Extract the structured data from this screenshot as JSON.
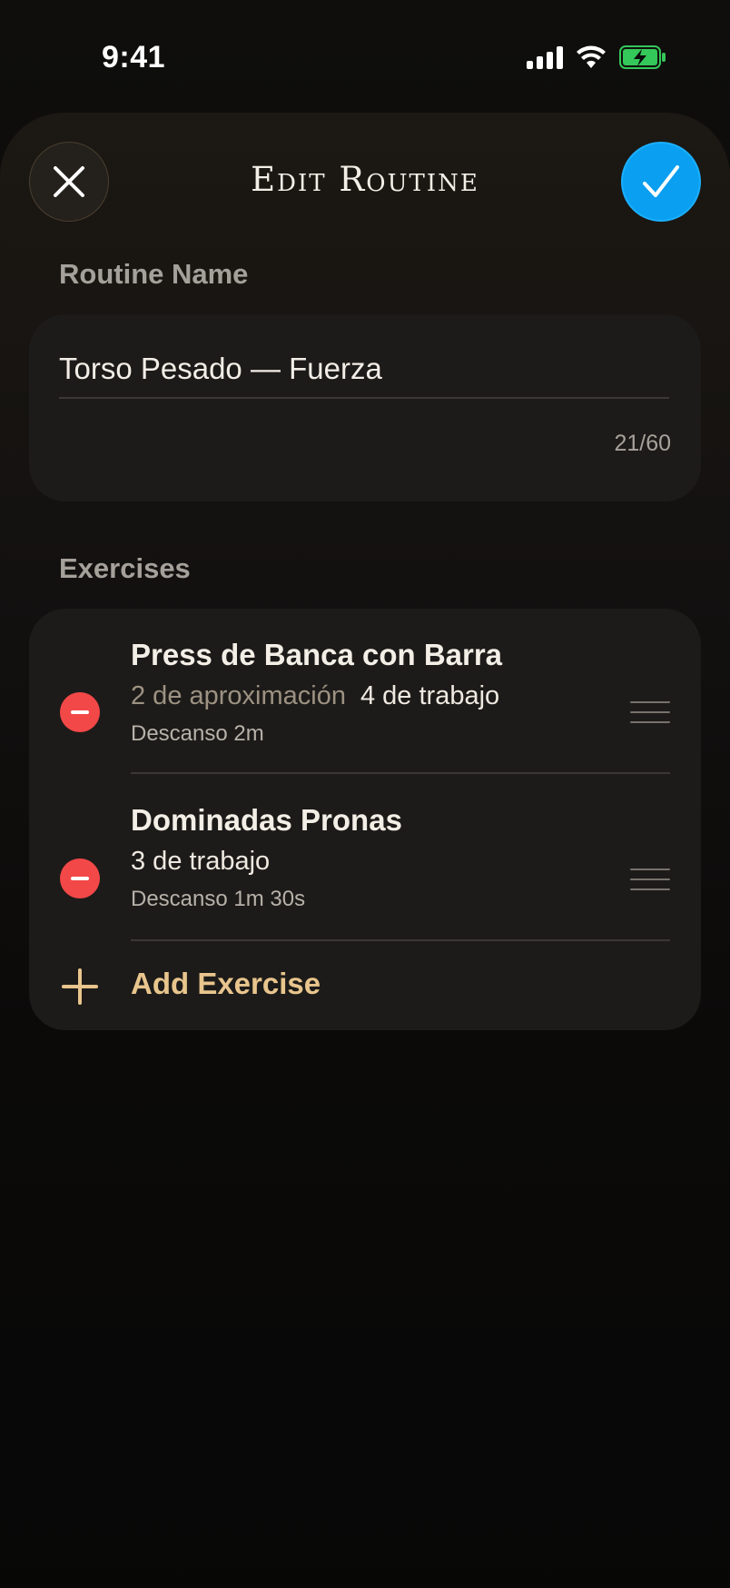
{
  "status_bar": {
    "time": "9:41",
    "icons": [
      "signal-icon",
      "wifi-icon",
      "battery-charging-icon"
    ],
    "battery_color": "#34c759"
  },
  "header": {
    "title": "Edit Routine",
    "close_icon": "close-icon",
    "confirm_icon": "checkmark-icon",
    "confirm_color": "#0a9ff0"
  },
  "routine_name": {
    "label": "Routine Name",
    "value": "Torso Pesado — Fuerza",
    "char_count": "21/60"
  },
  "exercises": {
    "label": "Exercises",
    "items": [
      {
        "name": "Press de Banca con Barra",
        "warmup_sets": "2 de aproximación",
        "working_sets": "4 de trabajo",
        "rest": "Descanso 2m"
      },
      {
        "name": "Dominadas Pronas",
        "warmup_sets": "",
        "working_sets": "3 de trabajo",
        "rest": "Descanso 1m 30s"
      }
    ],
    "add_label": "Add Exercise",
    "accent_color": "#e8c58d",
    "remove_color": "#f34848"
  }
}
